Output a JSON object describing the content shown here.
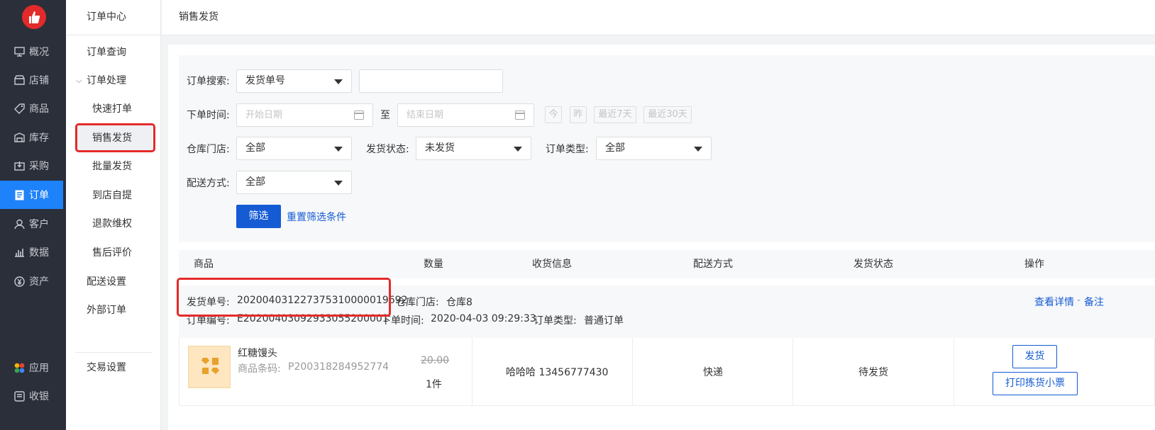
{
  "nav1": {
    "items": [
      {
        "label": "概况",
        "icon": "monitor-icon"
      },
      {
        "label": "店铺",
        "icon": "store-icon"
      },
      {
        "label": "商品",
        "icon": "tag-icon"
      },
      {
        "label": "库存",
        "icon": "warehouse-icon"
      },
      {
        "label": "采购",
        "icon": "purchase-icon"
      },
      {
        "label": "订单",
        "icon": "order-icon"
      },
      {
        "label": "客户",
        "icon": "user-icon"
      },
      {
        "label": "数据",
        "icon": "chart-icon"
      },
      {
        "label": "资产",
        "icon": "yen-icon"
      }
    ],
    "bottom": [
      {
        "label": "应用",
        "icon": "apps-icon"
      },
      {
        "label": "收银",
        "icon": "cashier-icon"
      }
    ],
    "active_index": 5
  },
  "nav2": {
    "title": "订单中心",
    "items": [
      "订单查询",
      "订单处理",
      "快速打单",
      "销售发货",
      "批量发货",
      "到店自提",
      "退款维权",
      "售后评价",
      "配送设置",
      "外部订单"
    ],
    "footer": "交易设置"
  },
  "page_title": "销售发货",
  "filter": {
    "search_label": "订单搜索:",
    "search_type": "发货单号",
    "search_value": "",
    "time_label": "下单时间:",
    "start_placeholder": "开始日期",
    "to": "至",
    "end_placeholder": "结束日期",
    "quick": [
      "今",
      "昨",
      "最近7天",
      "最近30天"
    ],
    "store_label": "仓库门店:",
    "store_value": "全部",
    "ship_status_label": "发货状态:",
    "ship_status_value": "未发货",
    "order_type_label": "订单类型:",
    "order_type_value": "全部",
    "delivery_label": "配送方式:",
    "delivery_value": "全部",
    "filter_btn": "筛选",
    "reset_link": "重置筛选条件"
  },
  "table": {
    "headers": [
      "商品",
      "数量",
      "收货信息",
      "配送方式",
      "发货状态",
      "操作"
    ]
  },
  "order": {
    "ship_no_label": "发货单号:",
    "ship_no": "20200403122737531000001969​2",
    "store_label": "仓库门店:",
    "store": "仓库8",
    "order_no_label": "订单编号:",
    "order_no": "E20200403092933055200001",
    "time_label": "下单时间:",
    "time": "2020-04-03 09:29:33",
    "type_label": "订单类型:",
    "type": "普通订单",
    "detail_link": "查看详情",
    "sep": "-",
    "remark_link": "备注",
    "product_name": "红糖馒头",
    "barcode_label": "商品条码:",
    "barcode": "P200318284952774",
    "price": "20.00",
    "qty": "1件",
    "receiver": "哈哈哈 13456777430",
    "delivery": "快递",
    "status": "待发货",
    "ship_btn": "发货",
    "print_btn": "打印拣货小票"
  },
  "colors": {
    "accent": "#155bd4",
    "nav_active": "#1e82fa",
    "nav_bg": "#2b2f3a",
    "annotation": "#e52a2a"
  }
}
